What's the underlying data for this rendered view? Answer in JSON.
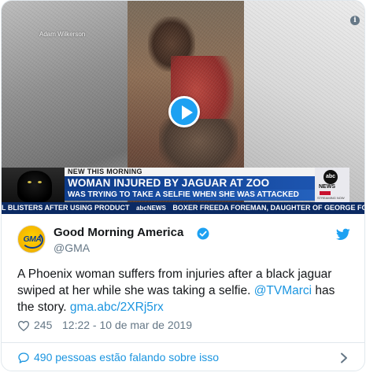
{
  "media": {
    "credit": "Adam Wilkerson",
    "lower_third": {
      "kicker": "NEW THIS MORNING",
      "headline": "WOMAN INJURED BY JAGUAR AT ZOO",
      "detail": "WAS TRYING TO TAKE A SELFIE WHEN SHE WAS ATTACKED",
      "network": "abc",
      "network_label": "NEWS",
      "network_sub": "STREAMING NOW"
    },
    "ticker": {
      "left": "L BLISTERS AFTER USING PRODUCT",
      "logo": "abcNEWS",
      "right": "BOXER FREEDA FOREMAN, DAUGHTER OF GEORGE FO"
    },
    "icons": {
      "info": "info-icon",
      "play": "play-icon"
    }
  },
  "author": {
    "avatar_text": "GMA",
    "name": "Good Morning America",
    "handle": "@GMA"
  },
  "tweet": {
    "text_before": "A Phoenix woman suffers from injuries after a black jaguar swiped at her while she was taking a selfie. ",
    "mention": "@TVMarci",
    "text_mid": " has the story. ",
    "link": "gma.abc/2XRj5rx"
  },
  "meta": {
    "likes": "245",
    "timestamp": "12:22 - 10 de mar de 2019"
  },
  "footer": {
    "conversation": "490 pessoas estão falando sobre isso"
  },
  "colors": {
    "twitter_blue": "#1da1f2",
    "link_blue": "#1b95e0",
    "secondary_gray": "#657786",
    "border": "#e1e8ed"
  }
}
